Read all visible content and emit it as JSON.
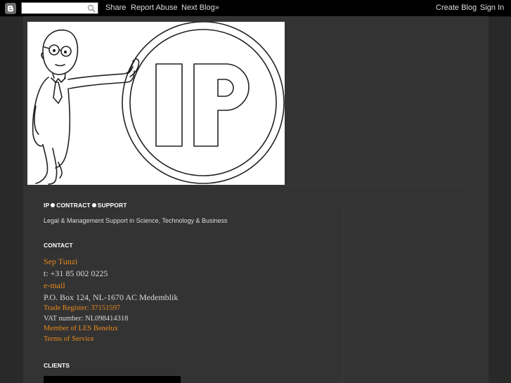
{
  "navbar": {
    "search_placeholder": "",
    "share_label": "Share",
    "report_abuse_label": "Report Abuse",
    "next_blog_label": "Next Blog»",
    "create_blog_label": "Create Blog",
    "sign_in_label": "Sign In"
  },
  "header": {
    "logo_text_i": "I",
    "logo_text_p": "P"
  },
  "sidebar": {
    "title": {
      "part1": "IP",
      "part2": "CONTRACT",
      "part3": "SUPPORT"
    },
    "tagline": "Legal & Management Support in Science, Technology & Business",
    "contact": {
      "heading": "CONTACT",
      "name": "Sep Tunzi",
      "phone": "t: +31 85 002 0225",
      "email": "e-mail",
      "address": "P.O. Box 124, NL-1670 AC Medemblik",
      "trade_register": "Trade Register: 37151597",
      "vat": "VAT number: NL098414318",
      "membership": "Member of LES Benelux",
      "terms": "Terms of Service"
    },
    "clients": {
      "heading": "CLIENTS"
    }
  },
  "colors": {
    "background": "#292929",
    "content_bg": "#333333",
    "link": "#e8891c",
    "navbar": "#000000"
  }
}
